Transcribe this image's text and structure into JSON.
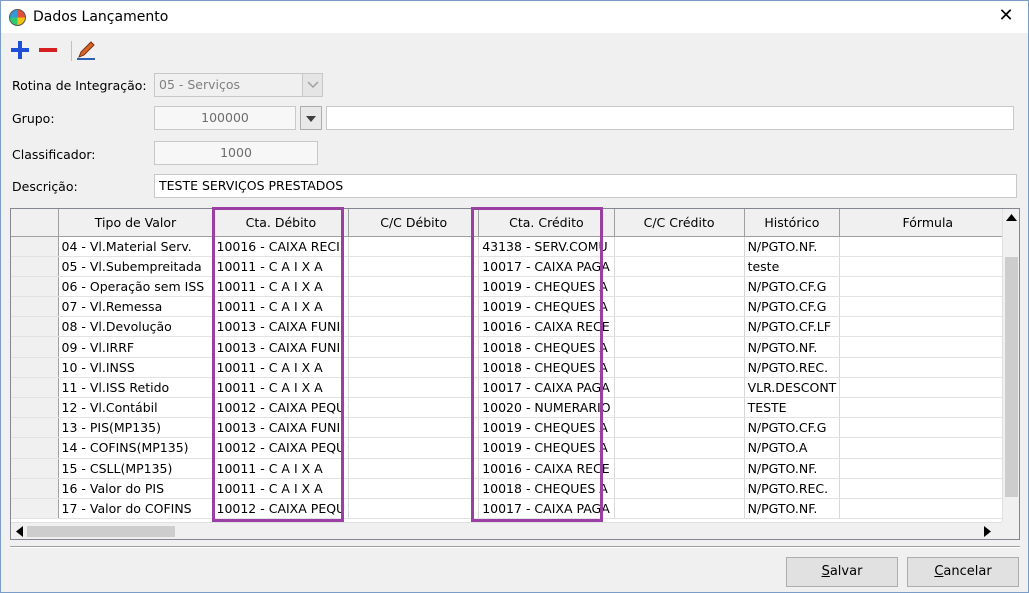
{
  "window": {
    "title": "Dados Lançamento",
    "close_glyph": "✕"
  },
  "toolbar": {
    "icons": [
      "add-icon",
      "remove-icon",
      "edit-icon"
    ]
  },
  "form": {
    "rotina_label": "Rotina de Integração:",
    "rotina_value": "05 - Serviços",
    "grupo_label": "Grupo:",
    "grupo_value": "100000",
    "grupo_desc": "",
    "classificador_label": "Classificador:",
    "classificador_value": "1000",
    "descricao_label": "Descrição:",
    "descricao_value": "TESTE SERVIÇOS PRESTADOS"
  },
  "grid": {
    "columns": [
      "Tipo de Valor",
      "Cta. Débito",
      "C/C Débito",
      "Cta. Crédito",
      "C/C Crédito",
      "Histórico",
      "Fórmula"
    ],
    "rows": [
      [
        "04 - Vl.Material Serv.",
        "10016 - CAIXA RECI",
        "",
        "43138 - SERV.COMU",
        "",
        "N/PGTO.NF.",
        ""
      ],
      [
        "05 - Vl.Subempreitada",
        "10011 - C A I X A",
        "",
        "10017 - CAIXA PAGA",
        "",
        "teste",
        ""
      ],
      [
        "06 - Operação sem ISS",
        "10011 - C A I X A",
        "",
        "10019 - CHEQUES A",
        "",
        "N/PGTO.CF.G",
        ""
      ],
      [
        "07 - Vl.Remessa",
        "10011 - C A I X A",
        "",
        "10019 - CHEQUES A",
        "",
        "N/PGTO.CF.G",
        ""
      ],
      [
        "08 - Vl.Devolução",
        "10013 - CAIXA FUNI",
        "",
        "10016 - CAIXA RECE",
        "",
        "N/PGTO.CF.LF",
        ""
      ],
      [
        "09 - Vl.IRRF",
        "10013 - CAIXA FUNI",
        "",
        "10018 - CHEQUES A",
        "",
        "N/PGTO.NF.",
        ""
      ],
      [
        "10 - Vl.INSS",
        "10011 - C A I X A",
        "",
        "10018 - CHEQUES A",
        "",
        "N/PGTO.REC.",
        ""
      ],
      [
        "11 - Vl.ISS Retido",
        "10011 - C A I X A",
        "",
        "10017 - CAIXA PAGA",
        "",
        "VLR.DESCONT",
        ""
      ],
      [
        "12 - Vl.Contábil",
        "10012 - CAIXA PEQU",
        "",
        "10020 - NUMERARIO",
        "",
        "TESTE",
        ""
      ],
      [
        "13 - PIS(MP135)",
        "10013 - CAIXA FUNI",
        "",
        "10019 - CHEQUES A",
        "",
        "N/PGTO.CF.G",
        ""
      ],
      [
        "14 - COFINS(MP135)",
        "10012 - CAIXA PEQU",
        "",
        "10019 - CHEQUES A",
        "",
        "N/PGTO.A",
        ""
      ],
      [
        "15 - CSLL(MP135)",
        "10011 - C A I X A",
        "",
        "10016 - CAIXA RECE",
        "",
        "N/PGTO.NF.",
        ""
      ],
      [
        "16 - Valor do PIS",
        "10011 - C A I X A",
        "",
        "10018 - CHEQUES A",
        "",
        "N/PGTO.REC.",
        ""
      ],
      [
        "17 - Valor do COFINS",
        "10012 - CAIXA PEQU",
        "",
        "10017 - CAIXA PAGA",
        "",
        "N/PGTO.NF.",
        ""
      ]
    ]
  },
  "buttons": {
    "save_hotkey": "S",
    "save_rest": "alvar",
    "cancel_hotkey": "C",
    "cancel_rest": "ancelar"
  },
  "colors": {
    "highlight": "#9b3fa5",
    "add": "#1f4fd6",
    "remove": "#d62020"
  }
}
